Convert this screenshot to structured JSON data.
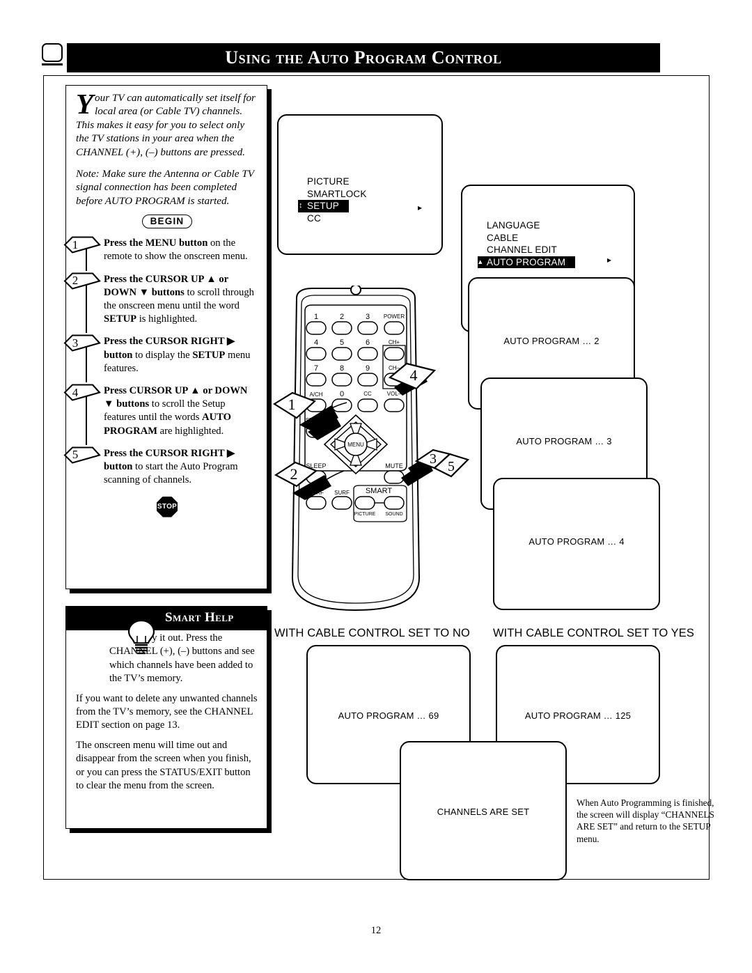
{
  "header": {
    "title": "Using the Auto Program Control",
    "icon": "tv-screen-icon"
  },
  "intro": {
    "dropcap": "Y",
    "paragraph1": "our TV can automatically set itself for local area (or Cable TV) channels. This makes it easy for you to select only the TV stations in your area when the CHANNEL (+), (–) buttons are pressed.",
    "note": "Note: Make sure the Antenna or Cable TV signal connection has been completed before AUTO PROGRAM is started.",
    "begin_label": "BEGIN"
  },
  "steps": [
    {
      "number": "1",
      "bold1": "Press the MENU button",
      "rest1": " on the remote to show the onscreen menu.",
      "bold2": "",
      "rest2": ""
    },
    {
      "number": "2",
      "bold1": "Press the CURSOR UP ▲ or DOWN ▼ buttons",
      "rest1": " to scroll through the onscreen menu until the word ",
      "bold2": "SETUP",
      "rest2": " is highlighted."
    },
    {
      "number": "3",
      "bold1": "Press the CURSOR RIGHT ▶ button",
      "rest1": " to display the ",
      "bold2": "SETUP",
      "rest2": " menu features."
    },
    {
      "number": "4",
      "bold1": "Press CURSOR UP ▲ or DOWN ▼ buttons",
      "rest1": " to scroll the Setup features until the words ",
      "bold2": "AUTO PROGRAM",
      "rest2": " are highlighted."
    },
    {
      "number": "5",
      "bold1": "Press the CURSOR RIGHT ▶ button",
      "rest1": " to start the Auto Program scanning of channels.",
      "bold2": "",
      "rest2": ""
    }
  ],
  "stop_label": "STOP",
  "smart_help": {
    "title": "Smart Help",
    "icon": "lightbulb-icon",
    "paragraphs": [
      "Try it out. Press the CHANNEL (+), (–) buttons and see which channels have been added to the TV’s memory.",
      "If you want to delete any unwanted channels from the TV’s memory, see the CHANNEL EDIT section on page 13.",
      "The onscreen menu will time out and disappear from the screen when you finish, or you can press the STATUS/EXIT button to clear the menu from the screen."
    ]
  },
  "osd_main_menu": {
    "items": [
      "PICTURE",
      "SMARTLOCK",
      "SETUP",
      "CC"
    ],
    "highlighted": "SETUP",
    "highlight_caret": "↕",
    "right_arrow": "▸"
  },
  "osd_setup_menu": {
    "items": [
      "LANGUAGE",
      "CABLE",
      "CHANNEL EDIT",
      "AUTO PROGRAM"
    ],
    "highlighted": "AUTO PROGRAM",
    "highlight_caret": "▴",
    "right_arrow": "▸"
  },
  "osd_progress": [
    "AUTO PROGRAM … 2",
    "AUTO PROGRAM … 3",
    "AUTO PROGRAM … 4"
  ],
  "cable_no": {
    "label": "WITH CABLE CONTROL SET TO NO",
    "screen_text": "AUTO PROGRAM … 69"
  },
  "cable_yes": {
    "label": "WITH CABLE CONTROL SET TO YES",
    "screen_text": "AUTO PROGRAM … 125"
  },
  "osd_final": {
    "screen_text": "CHANNELS ARE SET"
  },
  "endnote": "When Auto Programming is finished, the screen will display “CHANNELS ARE SET” and return to the SETUP menu.",
  "remote": {
    "keys_row1": [
      "1",
      "2",
      "3"
    ],
    "power": "POWER",
    "keys_row2": [
      "4",
      "5",
      "6"
    ],
    "chplus": "CH+",
    "keys_row3": [
      "7",
      "8",
      "9"
    ],
    "chminus": "CH–",
    "keys_row4": [
      "A/CH",
      "0",
      "CC"
    ],
    "volminus": "VOL–",
    "status": "STATUS",
    "menu": "MENU",
    "sleep": "SLEEP",
    "mute": "MUTE",
    "surf": "SURF",
    "smart": "SMART",
    "smart_picture": "PICTURE",
    "smart_sound": "SOUND"
  },
  "callouts": [
    "1",
    "2",
    "3",
    "4",
    "5"
  ],
  "page_number": "12"
}
